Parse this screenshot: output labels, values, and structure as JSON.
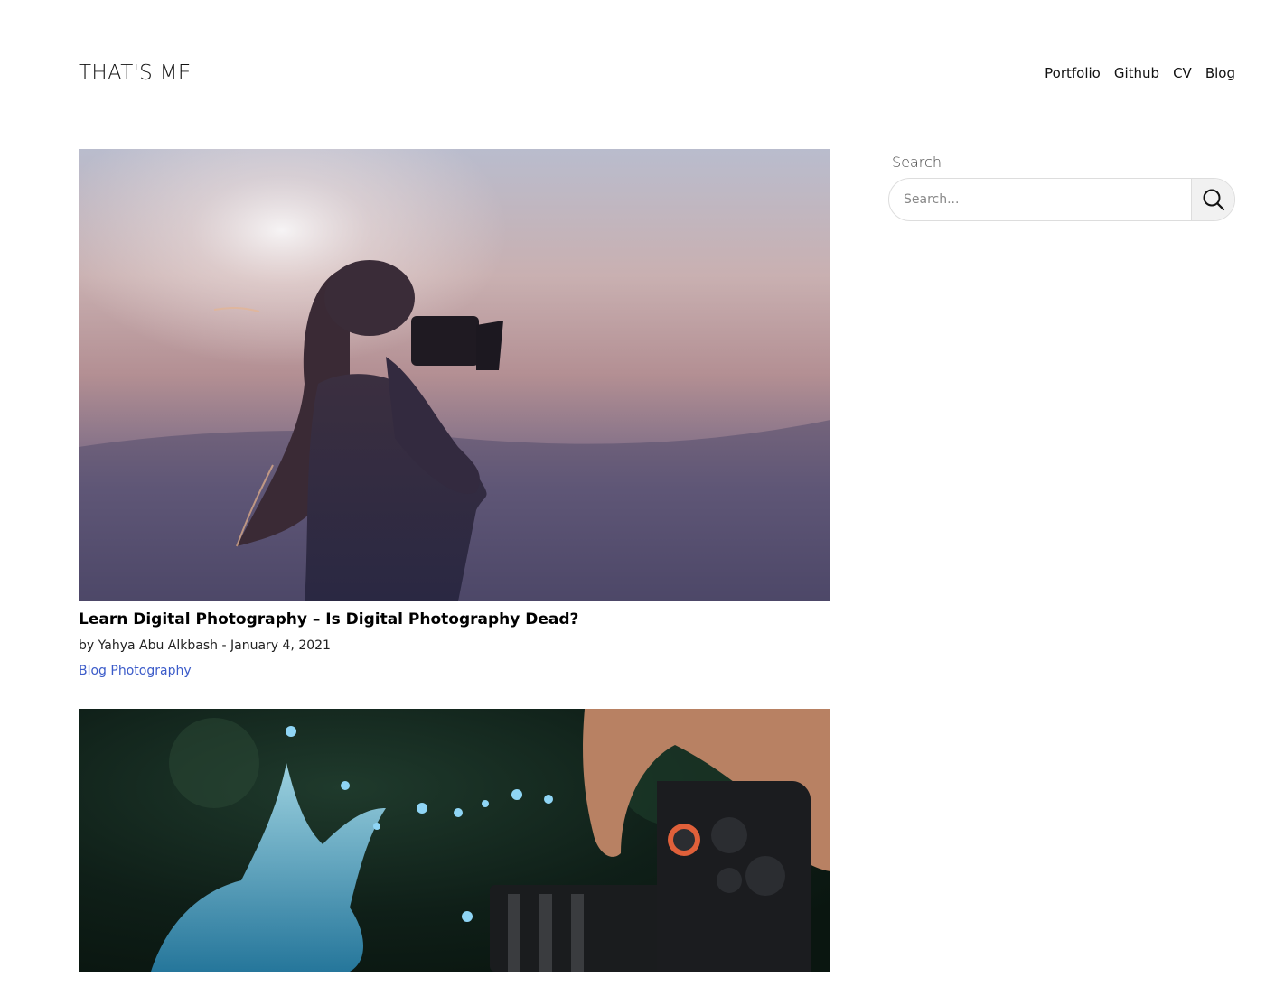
{
  "header": {
    "site_title": "THAT'S ME",
    "nav": [
      {
        "label": "Portfolio"
      },
      {
        "label": "Github"
      },
      {
        "label": "CV"
      },
      {
        "label": "Blog"
      }
    ]
  },
  "posts": [
    {
      "title": "Learn Digital Photography – Is Digital Photography Dead?",
      "author_prefix": "by",
      "author": "Yahya Abu Alkbash",
      "separator": "-",
      "date": "January 4, 2021",
      "categories": [
        {
          "label": "Blog"
        },
        {
          "label": "Photography"
        }
      ],
      "image": "woman-with-camera-sunset-photo"
    },
    {
      "image": "camera-water-splash-photo"
    }
  ],
  "sidebar": {
    "search": {
      "label": "Search",
      "placeholder": "Search...",
      "value": "",
      "button_icon": "search-icon"
    }
  }
}
